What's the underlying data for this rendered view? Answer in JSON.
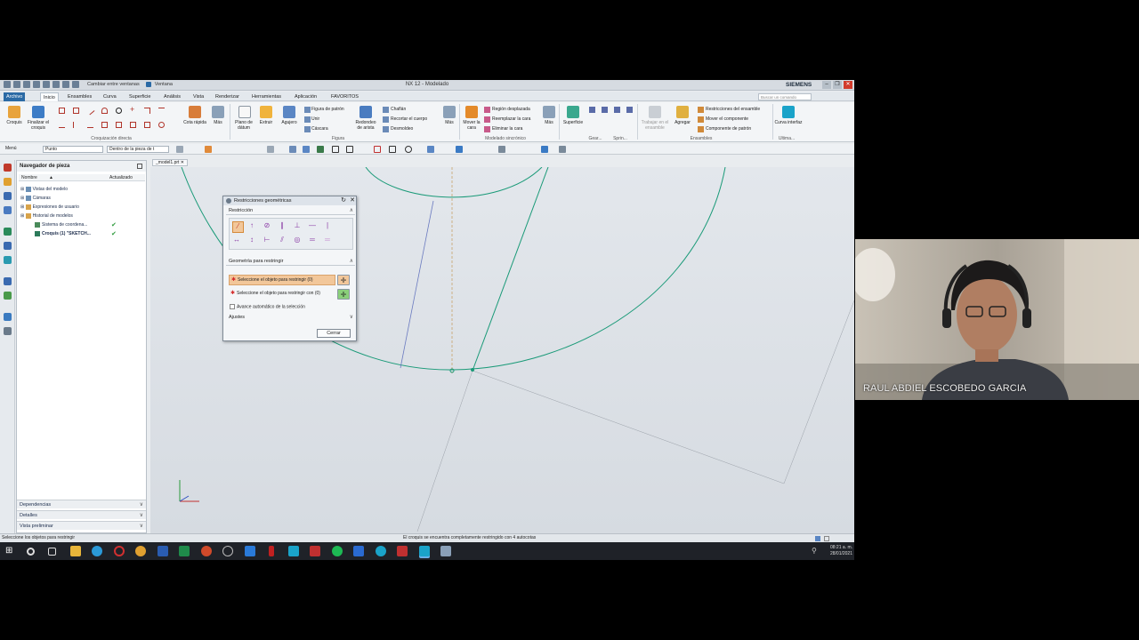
{
  "window": {
    "title": "NX 12 - Modelado",
    "brand": "SIEMENS",
    "qat_switch": "Cambiar entre ventanas",
    "qat_window": "Ventana"
  },
  "menu": {
    "tabs": [
      "Archivo",
      "Inicio",
      "Ensambles",
      "Curva",
      "Superficie",
      "Análisis",
      "Vista",
      "Renderizar",
      "Herramientas",
      "Aplicación",
      "FAVORITOS"
    ],
    "search_placeholder": "Buscar un comando"
  },
  "ribbon": {
    "croquis": "Croquis",
    "finalizar": "Finalizar el croquis",
    "cota_rapida": "Cota rápida",
    "mas1": "Más",
    "group_croquis": "Croquización directa",
    "plano": "Plano de dátum",
    "extruir": "Extruir",
    "agujero": "Agujero",
    "figura_patron": "Figura de patrón",
    "unir": "Unir",
    "cascara": "Cáscara",
    "group_feature": "Figura",
    "redondeo": "Redondeo de arista",
    "chaflan": "Chaflán",
    "recortar": "Recortar el cuerpo",
    "desmoldeo": "Desmoldeo",
    "mas2": "Más",
    "mover_cara": "Mover la cara",
    "region": "Región desplazada",
    "reemplazar": "Reemplazar la cara",
    "eliminar": "Eliminar la cara",
    "group_sync": "Modelado sincrónico",
    "mas3": "Más",
    "superficie": "Superficie",
    "group_gear": "Gear...",
    "group_spring": "Sprin...",
    "trabajar": "Trabajar en el ensamble",
    "agregar": "Agregar",
    "restricciones_ens": "Restricciones del ensamble",
    "mover_comp": "Mover el componente",
    "comp_patron": "Componente de patrón",
    "group_ens": "Ensambles",
    "curva_interfaz": "Curva interfaz",
    "group_ultima": "Ultima..."
  },
  "toolbar2": {
    "menu": "Menú",
    "filter": "Punto",
    "scope": "Dentro de la pieza de t"
  },
  "navigator": {
    "title": "Navegador de pieza",
    "col_name": "Nombre",
    "col_updated": "Actualizado",
    "rows": [
      {
        "label": "Vistas del modelo",
        "indent": 0,
        "check": ""
      },
      {
        "label": "Cámaras",
        "indent": 0,
        "check": ""
      },
      {
        "label": "Expresiones de usuario",
        "indent": 0,
        "check": ""
      },
      {
        "label": "Historial de modelos",
        "indent": 0,
        "check": ""
      },
      {
        "label": "Sistema de coordena...",
        "indent": 1,
        "check": "✔"
      },
      {
        "label": "Croquis (1) \"SKETCH...",
        "indent": 1,
        "check": "✔"
      }
    ],
    "dependencias": "Dependencias",
    "detalles": "Detalles",
    "vista_preliminar": "Vista preliminar"
  },
  "document_tab": "_model1.prt",
  "dialog": {
    "title": "Restricciones geométricas",
    "section_restriccion": "Restricción",
    "section_geometria": "Geometría para restringir",
    "select1": "Seleccione el objeto para restringir (0)",
    "select2": "Seleccione el objeto para restringir con (0)",
    "auto_advance": "Avance automático de la selección",
    "section_ajustes": "Ajustes",
    "close": "Cerrar"
  },
  "status": {
    "left": "Seleccione los objetos para restringir",
    "center": "El croquis se encuentra completamente restringido con 4 autocotas"
  },
  "taskbar": {
    "time": "08:21 a. m.",
    "date": "28/01/2021"
  },
  "webcam": {
    "name": "RAUL ABDIEL ESCOBEDO GARCIA"
  },
  "colors": {
    "sketch_curve": "#1a9a78",
    "file_tab": "#2b6aa5",
    "dialog_selected": "#f2c79a"
  }
}
